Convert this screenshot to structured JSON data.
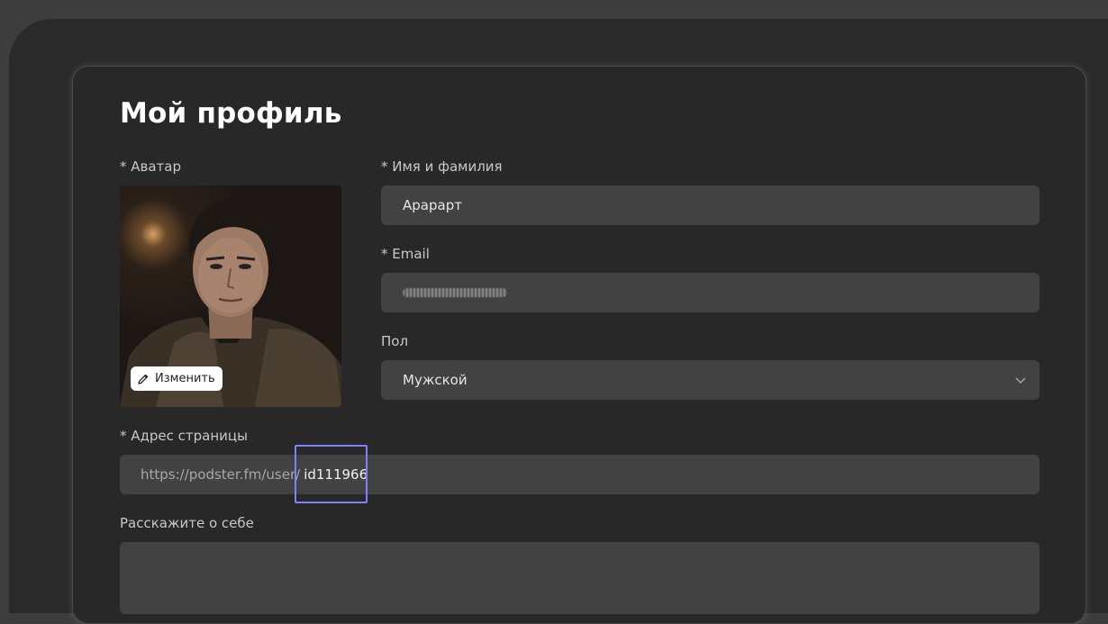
{
  "page": {
    "title": "Мой профиль"
  },
  "avatar": {
    "label": "* Аватар",
    "change_label": "Изменить"
  },
  "name_field": {
    "label": "* Имя и фамилия",
    "value": "Арарарт"
  },
  "email_field": {
    "label": "* Email"
  },
  "gender_field": {
    "label": "Пол",
    "value": "Мужской"
  },
  "url_field": {
    "label": "* Адрес страницы",
    "prefix": "https://podster.fm/user/",
    "value": "id111966"
  },
  "about_field": {
    "label": "Расскажите о себе"
  },
  "icons": {
    "change": "pencil-icon",
    "gender_dropdown": "chevron-down-icon"
  },
  "colors": {
    "background": "#2a2a2a",
    "card": "#282828",
    "input": "#424242",
    "highlight": "#7f7fff"
  }
}
